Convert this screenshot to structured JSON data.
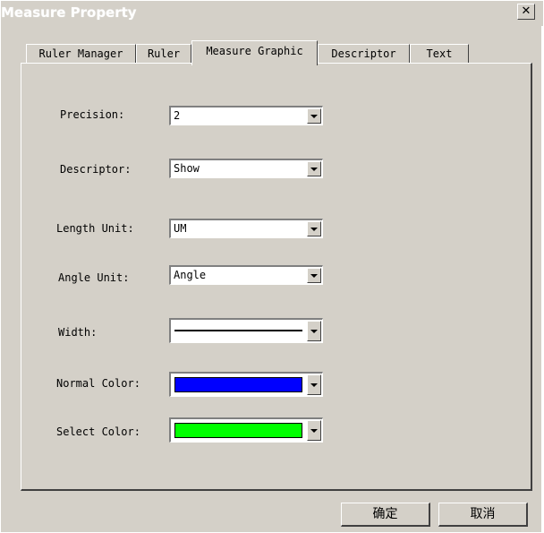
{
  "window": {
    "title": "Measure Property"
  },
  "tabs": [
    {
      "label": "Ruler Manager"
    },
    {
      "label": "Ruler"
    },
    {
      "label": "Measure Graphic"
    },
    {
      "label": "Descriptor"
    },
    {
      "label": "Text"
    }
  ],
  "form": {
    "precision": {
      "label": "Precision:",
      "value": "2"
    },
    "descriptor": {
      "label": "Descriptor:",
      "value": "Show"
    },
    "length_unit": {
      "label": "Length Unit:",
      "value": "UM"
    },
    "angle_unit": {
      "label": "Angle Unit:",
      "value": "Angle"
    },
    "width": {
      "label": "Width:"
    },
    "normal_color": {
      "label": "Normal Color:",
      "color": "#0000ff"
    },
    "select_color": {
      "label": "Select Color:",
      "color": "#00ff00"
    }
  },
  "buttons": {
    "ok": "确定",
    "cancel": "取消"
  },
  "colors": {
    "face": "#d4d0c8"
  }
}
